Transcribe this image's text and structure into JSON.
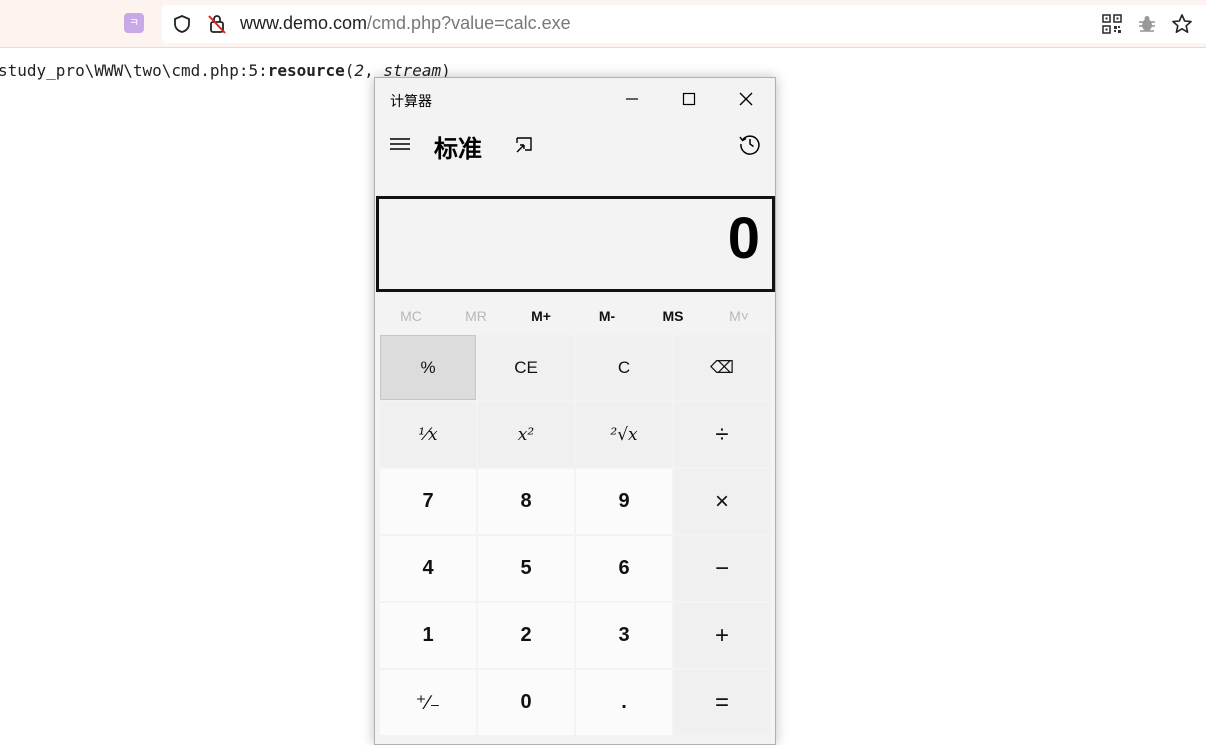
{
  "browser": {
    "url_host": "www.demo.com",
    "url_path": "/cmd.php?value=calc.exe",
    "ext_label": "ㅋ"
  },
  "page": {
    "php_prefix": "study_pro\\WWW\\two\\cmd.php:5:",
    "php_bold": "resource",
    "php_open": "(",
    "php_num": "2",
    "php_sep": ", ",
    "php_type": "stream",
    "php_close": ")"
  },
  "calculator": {
    "window_title": "计算器",
    "mode_title": "标准",
    "display_value": "0",
    "memory": {
      "mc": "MC",
      "mr": "MR",
      "mplus": "M+",
      "mminus": "M-",
      "ms": "MS",
      "mlist": "M˅"
    },
    "keys": {
      "percent": "%",
      "ce": "CE",
      "c": "C",
      "backspace": "⌫",
      "reciprocal": "¹⁄x",
      "square": "x²",
      "sqrt": "²√x",
      "divide": "÷",
      "seven": "7",
      "eight": "8",
      "nine": "9",
      "multiply": "×",
      "four": "4",
      "five": "5",
      "six": "6",
      "minus": "−",
      "one": "1",
      "two": "2",
      "three": "3",
      "plus": "+",
      "negate": "⁺∕₋",
      "zero": "0",
      "decimal": ".",
      "equals": "="
    }
  }
}
